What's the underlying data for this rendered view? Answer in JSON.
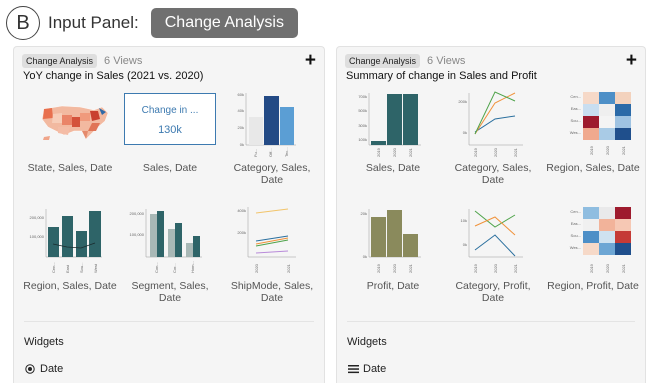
{
  "header": {
    "badge": "B",
    "label": "Input Panel:",
    "selection": "Change Analysis"
  },
  "panels": [
    {
      "tag": "Change Analysis",
      "views": "6 Views",
      "title": "YoY change in Sales (2021 vs. 2020)",
      "cards": [
        {
          "caption": "State, Sales, Date"
        },
        {
          "caption": "Sales, Date",
          "kpi_title": "Change in ...",
          "kpi_value": "130k"
        },
        {
          "caption": "Category, Sales, Date",
          "yticks": [
            "60k",
            "40k",
            "20k",
            "0k"
          ],
          "xticks": [
            "Fu...",
            "Off...",
            "Tec..."
          ]
        },
        {
          "caption": "Region, Sales, Date",
          "yticks": [
            "200,000",
            "100,000"
          ],
          "xticks": [
            "Cen...",
            "East",
            "Sou...",
            "West"
          ]
        },
        {
          "caption": "Segment, Sales, Date",
          "yticks": [
            "200,000",
            "100,000"
          ],
          "xticks": [
            "Con...",
            "Cor...",
            "Hom..."
          ]
        },
        {
          "caption": "ShipMode, Sales, Date",
          "yticks": [
            "400k",
            "200k"
          ],
          "xticks": [
            "2020",
            "2021"
          ]
        }
      ],
      "widgets_title": "Widgets",
      "widget": {
        "label": "Date",
        "icon": "radio-icon"
      }
    },
    {
      "tag": "Change Analysis",
      "views": "6 Views",
      "title": "Summary of change in Sales and Profit",
      "cards": [
        {
          "caption": "Sales, Date",
          "yticks": [
            "700k",
            "500k",
            "300k",
            "100k"
          ],
          "xticks": [
            "2019",
            "2020",
            "2021"
          ]
        },
        {
          "caption": "Category, Sales, Date",
          "yticks": [
            "200k",
            "0k"
          ],
          "xticks": [
            "2019",
            "2020",
            "2021"
          ]
        },
        {
          "caption": "Region, Sales, Date",
          "yticks": [
            "Cen...",
            "Eas...",
            "Sou...",
            "Wes..."
          ],
          "xticks": [
            "2019",
            "2020",
            "2021"
          ]
        },
        {
          "caption": "Profit, Date",
          "yticks": [
            "20k",
            "0k"
          ],
          "xticks": [
            "2019",
            "2020",
            "2021"
          ]
        },
        {
          "caption": "Category, Profit, Date",
          "yticks": [
            "10k",
            "0k"
          ],
          "xticks": [
            "2019",
            "2020",
            "2021"
          ]
        },
        {
          "caption": "Region, Profit, Date",
          "yticks": [
            "Cen...",
            "Eas...",
            "Sou...",
            "Wes..."
          ],
          "xticks": [
            "2019",
            "2020",
            "2021"
          ]
        }
      ],
      "widgets_title": "Widgets",
      "widget": {
        "label": "Date",
        "icon": "list-icon"
      }
    }
  ],
  "colors": {
    "teal": "#2e6468",
    "blue": "#3d7ab0",
    "olive": "#8a8a5c",
    "orange": "#f0923a",
    "green": "#4ea34a"
  }
}
